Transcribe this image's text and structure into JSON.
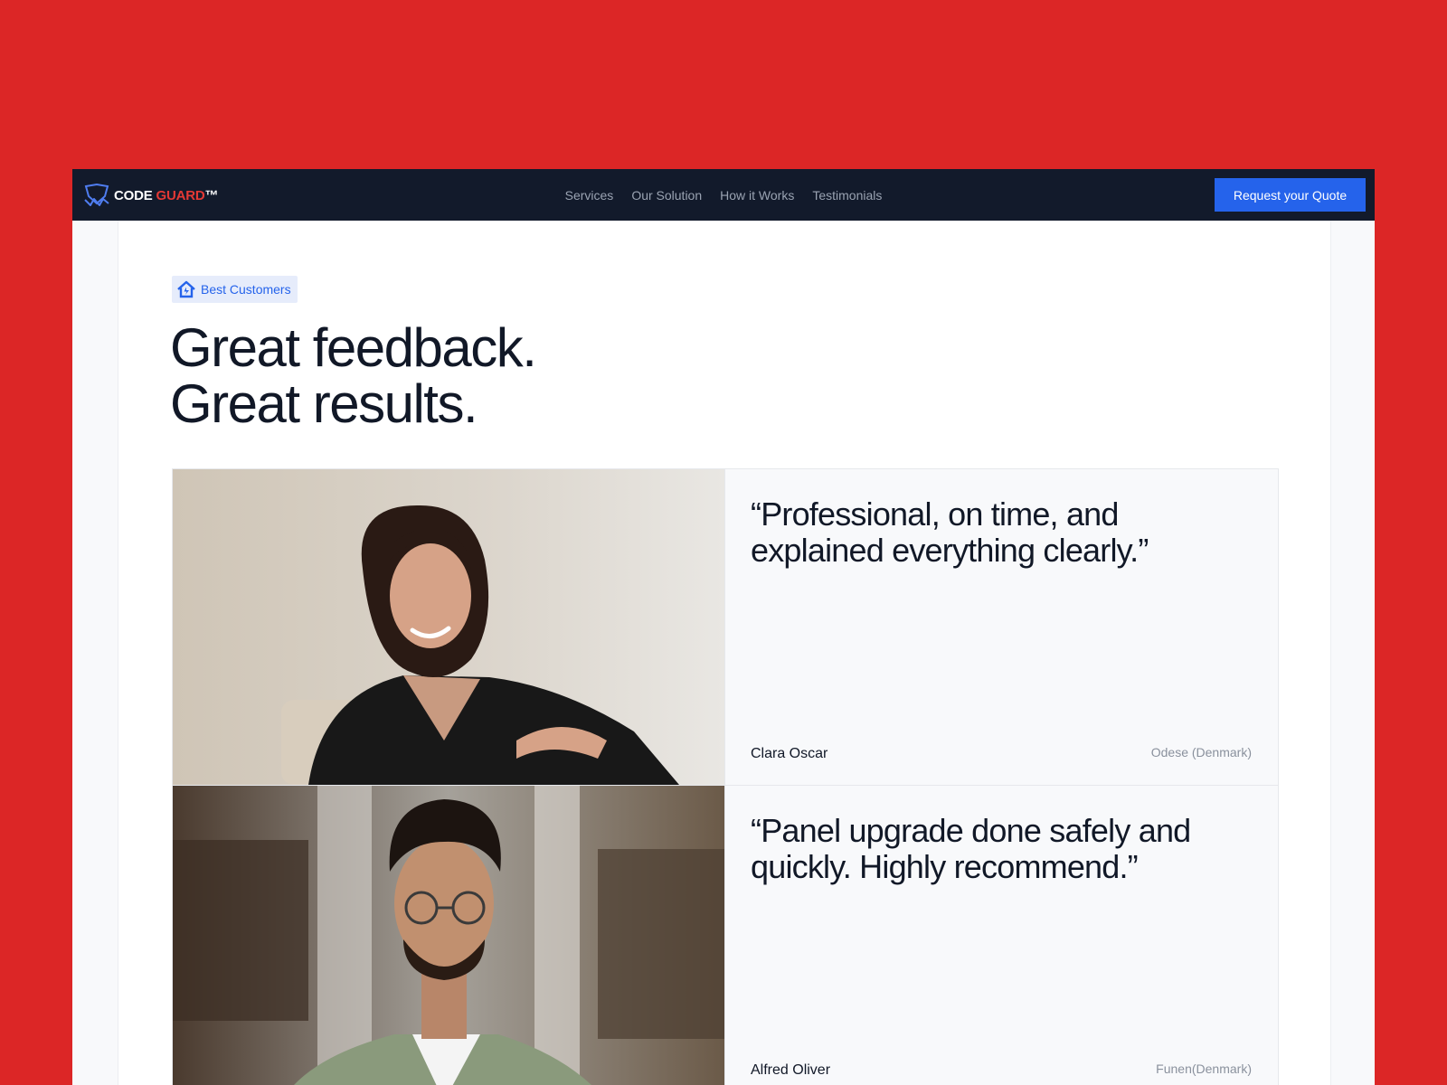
{
  "colors": {
    "background": "#dc2626",
    "navbar": "#121a2b",
    "primary": "#2563eb",
    "brand_accent": "#e53935"
  },
  "brand": {
    "name_part1": "CODE",
    "name_part2": "GUARD",
    "trademark": "™",
    "logo_icon": "shield-bolt-icon"
  },
  "nav": {
    "links": [
      "Services",
      "Our Solution",
      "How it Works",
      "Testimonials"
    ]
  },
  "cta": {
    "label": "Request your Quote"
  },
  "section": {
    "badge_icon": "house-icon",
    "badge_label": "Best Customers",
    "headline_line1": "Great feedback.",
    "headline_line2": "Great results."
  },
  "testimonials": [
    {
      "quote": "“Professional, on time, and explained everything clearly.”",
      "name": "Clara Oscar",
      "location": "Odese (Denmark)",
      "photo": "woman-portrait-photo"
    },
    {
      "quote": "“Panel upgrade done safely and quickly. Highly recommend.”",
      "name": "Alfred Oliver",
      "location": "Funen(Denmark)",
      "photo": "man-portrait-photo"
    }
  ]
}
